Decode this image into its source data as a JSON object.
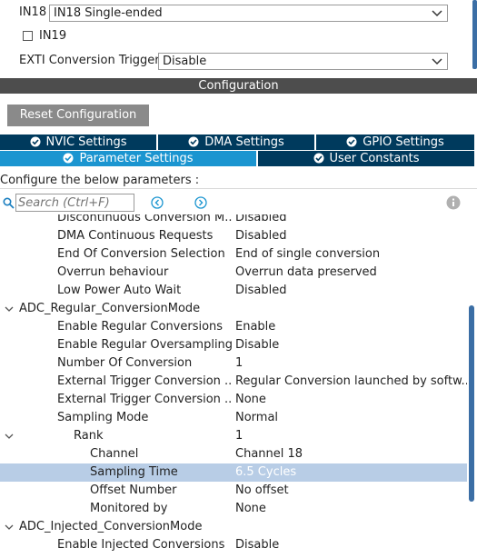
{
  "top": {
    "in18_label": "IN18",
    "in18_value": "IN18 Single-ended",
    "in19_label": "IN19",
    "exti_label": "EXTI Conversion Trigger",
    "exti_value": "Disable"
  },
  "config_title": "Configuration",
  "reset_button": "Reset Configuration",
  "tabs": [
    {
      "label": "NVIC Settings"
    },
    {
      "label": "DMA Settings"
    },
    {
      "label": "GPIO Settings"
    },
    {
      "label": "Parameter Settings"
    },
    {
      "label": "User Constants"
    }
  ],
  "param_header": "Configure the below parameters :",
  "search": {
    "placeholder": "Search (Ctrl+F)"
  },
  "rows": [
    {
      "name": "Discontinuous Conversion M...",
      "value": "Disabled"
    },
    {
      "name": "DMA Continuous Requests",
      "value": "Disabled"
    },
    {
      "name": "End Of Conversion Selection",
      "value": "End of single conversion"
    },
    {
      "name": "Overrun behaviour",
      "value": "Overrun data preserved"
    },
    {
      "name": "Low Power Auto Wait",
      "value": "Disabled"
    },
    {
      "name": "ADC_Regular_ConversionMode",
      "value": ""
    },
    {
      "name": "Enable Regular Conversions",
      "value": "Enable"
    },
    {
      "name": "Enable Regular Oversampling",
      "value": "Disable"
    },
    {
      "name": "Number Of Conversion",
      "value": "1"
    },
    {
      "name": "External Trigger Conversion ...",
      "value": "Regular Conversion launched by softw..."
    },
    {
      "name": "External Trigger Conversion ...",
      "value": "None"
    },
    {
      "name": "Sampling Mode",
      "value": "Normal"
    },
    {
      "name": "Rank",
      "value": "1"
    },
    {
      "name": "Channel",
      "value": "Channel 18"
    },
    {
      "name": "Sampling Time",
      "value": "6.5 Cycles"
    },
    {
      "name": "Offset Number",
      "value": "No offset"
    },
    {
      "name": "Monitored by",
      "value": "None"
    },
    {
      "name": "ADC_Injected_ConversionMode",
      "value": ""
    },
    {
      "name": "Enable Injected Conversions",
      "value": "Disable"
    }
  ],
  "colors": {
    "tab_dark": "#003a5d",
    "tab_active": "#1b95d0",
    "selected_row": "#b8cde6",
    "scroll": "#3b6ea5"
  }
}
